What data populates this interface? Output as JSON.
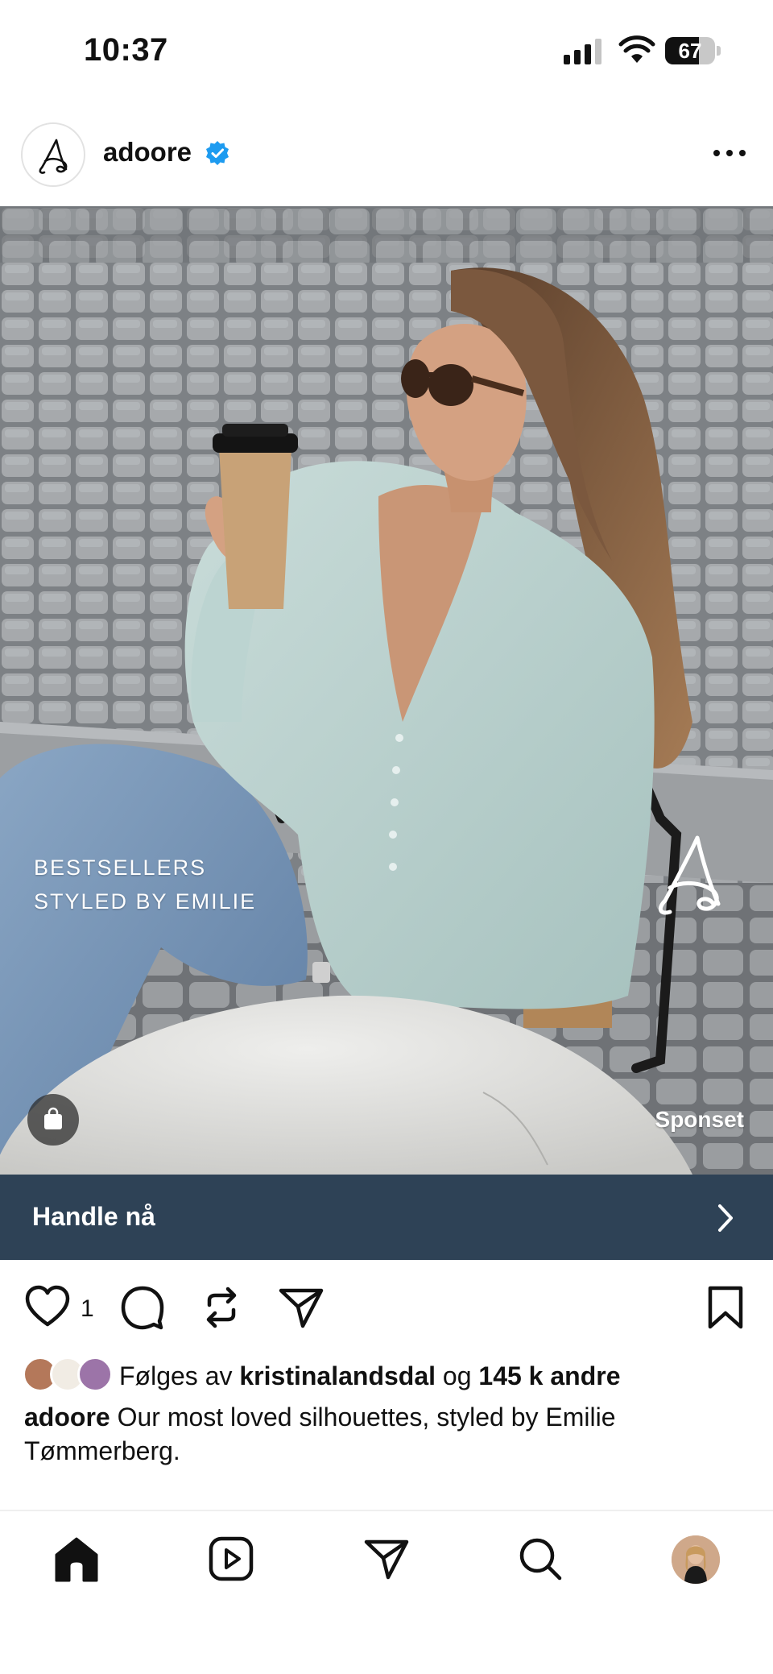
{
  "status_bar": {
    "time": "10:37",
    "battery_level": "67",
    "battery_fraction": 0.67,
    "signal_icon": "cellular-signal-icon",
    "wifi_icon": "wifi-icon"
  },
  "post": {
    "account_name": "adoore",
    "verified": true,
    "avatar_icon": "adoore-logo-icon",
    "more_icon": "more-horizontal-icon",
    "image": {
      "overlay_line1": "BESTSELLERS",
      "overlay_line2": "STYLED BY EMILIE",
      "sponsored_label": "Sponset",
      "shop_icon": "shopping-bag-icon"
    },
    "cta": {
      "label": "Handle nå",
      "icon": "chevron-right-icon",
      "background": "#2e4256"
    },
    "actions": {
      "like_count": "1",
      "icons": [
        "heart-icon",
        "comment-icon",
        "repost-icon",
        "share-icon",
        "bookmark-icon"
      ]
    },
    "followed_by": {
      "prefix": "Følges av",
      "user": "kristinalandsdal",
      "conjunction": "og",
      "others": "145 k andre"
    },
    "caption": {
      "username": "adoore",
      "text": "Our most loved silhouettes, styled by Emilie Tømmerberg."
    }
  },
  "bottom_nav": {
    "items": [
      "home-icon",
      "reels-icon",
      "messages-icon",
      "search-icon",
      "profile-avatar"
    ]
  },
  "colors": {
    "accent_verified": "#1d9bf0",
    "cta_bar": "#2e4256",
    "text": "#111111"
  }
}
